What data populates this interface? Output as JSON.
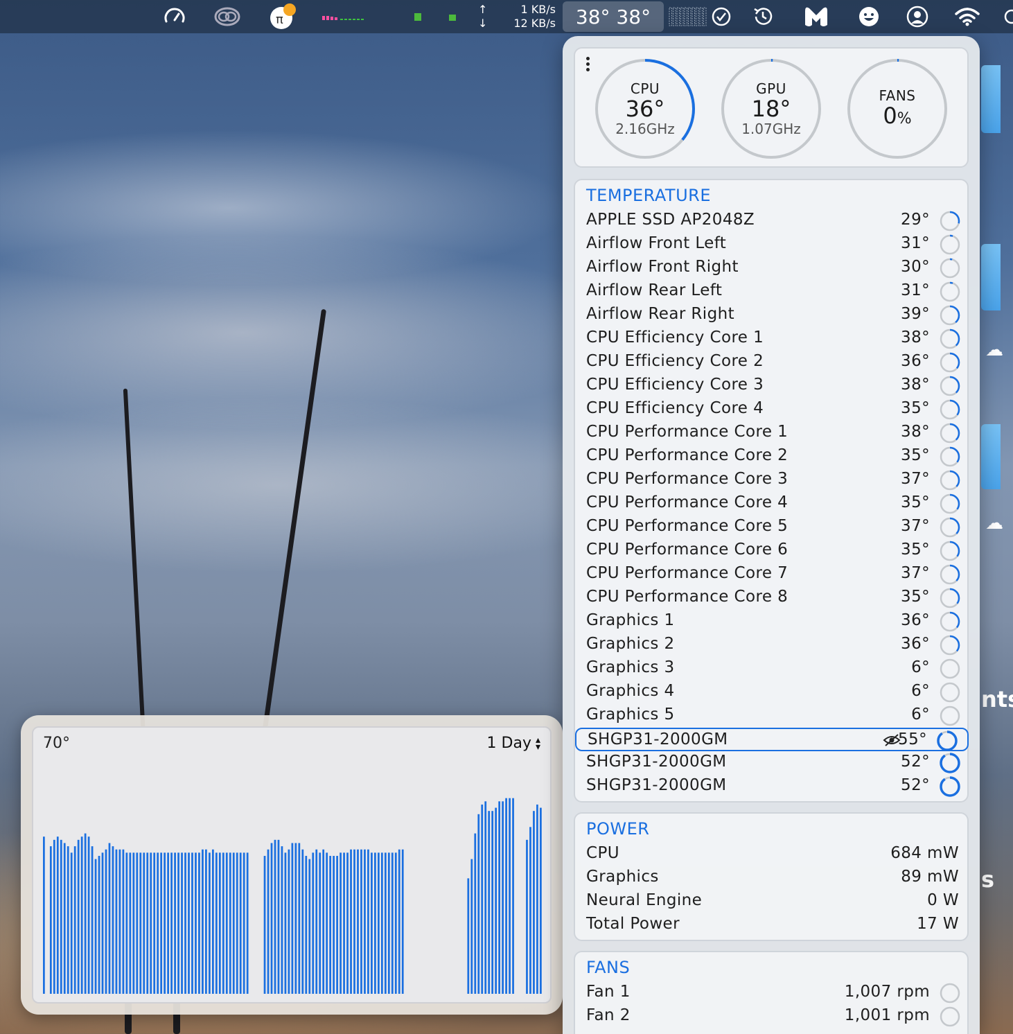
{
  "menubar": {
    "net_up": "1 KB/s",
    "net_down": "12 KB/s",
    "temps": "38° 38°",
    "icons": [
      "speedometer-icon",
      "creative-cloud-icon",
      "notification-badge-icon",
      "memory-bars-icon",
      "status-dots-icon",
      "network-arrows-icon",
      "cpu-grid-icon",
      "checkmark-circle-icon",
      "time-machine-icon",
      "malwarebytes-icon",
      "smiley-icon",
      "user-account-icon",
      "wifi-icon"
    ],
    "accent": "#1a6fe0"
  },
  "history": {
    "max_label": "70°",
    "range": "1 Day",
    "chart_data": {
      "type": "bar",
      "title": "",
      "xlabel": "",
      "ylabel": "",
      "ylim": [
        0,
        70
      ],
      "values": [
        49,
        0,
        46,
        48,
        49,
        48,
        47,
        46,
        44,
        46,
        48,
        49,
        50,
        49,
        46,
        42,
        43,
        44,
        45,
        47,
        46,
        45,
        45,
        45,
        44,
        44,
        44,
        44,
        44,
        44,
        44,
        44,
        44,
        44,
        44,
        44,
        44,
        44,
        44,
        44,
        44,
        44,
        44,
        44,
        44,
        44,
        45,
        45,
        44,
        45,
        44,
        44,
        44,
        44,
        44,
        44,
        44,
        44,
        44,
        44,
        0,
        0,
        0,
        0,
        43,
        45,
        47,
        48,
        48,
        46,
        44,
        45,
        47,
        47,
        47,
        45,
        43,
        42,
        44,
        45,
        44,
        45,
        44,
        43,
        43,
        43,
        44,
        44,
        44,
        45,
        45,
        45,
        45,
        45,
        45,
        44,
        44,
        44,
        44,
        44,
        44,
        44,
        44,
        45,
        45,
        0,
        0,
        0,
        0,
        0,
        0,
        0,
        0,
        0,
        0,
        0,
        0,
        0,
        0,
        0,
        0,
        0,
        0,
        36,
        42,
        50,
        56,
        59,
        60,
        57,
        57,
        58,
        60,
        60,
        61,
        61,
        61,
        0,
        0,
        0,
        48,
        52,
        57,
        59,
        58
      ]
    }
  },
  "gauges": [
    {
      "label": "CPU",
      "value": "36°",
      "sub": "2.16GHz",
      "fill": 0.36
    },
    {
      "label": "GPU",
      "value": "18°",
      "sub": "1.07GHz",
      "fill": 0.0
    },
    {
      "label": "FANS",
      "value": "0",
      "unit": "%",
      "sub": "",
      "fill": 0.0
    }
  ],
  "temperature": {
    "title": "TEMPERATURE",
    "rows": [
      {
        "name": "APPLE SSD AP2048Z",
        "value": "29°",
        "fill": 0.29
      },
      {
        "name": "Airflow Front Left",
        "value": "31°",
        "fill": 0.05
      },
      {
        "name": "Airflow Front Right",
        "value": "30°",
        "fill": 0.04
      },
      {
        "name": "Airflow Rear Left",
        "value": "31°",
        "fill": 0.05
      },
      {
        "name": "Airflow Rear Right",
        "value": "39°",
        "fill": 0.39
      },
      {
        "name": "CPU Efficiency Core 1",
        "value": "38°",
        "fill": 0.38
      },
      {
        "name": "CPU Efficiency Core 2",
        "value": "36°",
        "fill": 0.36
      },
      {
        "name": "CPU Efficiency Core 3",
        "value": "38°",
        "fill": 0.38
      },
      {
        "name": "CPU Efficiency Core 4",
        "value": "35°",
        "fill": 0.35
      },
      {
        "name": "CPU Performance Core 1",
        "value": "38°",
        "fill": 0.38
      },
      {
        "name": "CPU Performance Core 2",
        "value": "35°",
        "fill": 0.35
      },
      {
        "name": "CPU Performance Core 3",
        "value": "37°",
        "fill": 0.37
      },
      {
        "name": "CPU Performance Core 4",
        "value": "35°",
        "fill": 0.35
      },
      {
        "name": "CPU Performance Core 5",
        "value": "37°",
        "fill": 0.37
      },
      {
        "name": "CPU Performance Core 6",
        "value": "35°",
        "fill": 0.35
      },
      {
        "name": "CPU Performance Core 7",
        "value": "37°",
        "fill": 0.37
      },
      {
        "name": "CPU Performance Core 8",
        "value": "35°",
        "fill": 0.35
      },
      {
        "name": "Graphics 1",
        "value": "36°",
        "fill": 0.36
      },
      {
        "name": "Graphics 2",
        "value": "36°",
        "fill": 0.36
      },
      {
        "name": "Graphics 3",
        "value": "6°",
        "fill": 0.0
      },
      {
        "name": "Graphics 4",
        "value": "6°",
        "fill": 0.0
      },
      {
        "name": "Graphics 5",
        "value": "6°",
        "fill": 0.0
      },
      {
        "name": "SHGP31-2000GM",
        "value": "55°",
        "fill": 0.9,
        "selected": true,
        "hidden_from_menubar": true
      },
      {
        "name": "SHGP31-2000GM",
        "value": "52°",
        "fill": 0.9
      },
      {
        "name": "SHGP31-2000GM",
        "value": "52°",
        "fill": 0.9
      }
    ]
  },
  "power": {
    "title": "POWER",
    "rows": [
      {
        "name": "CPU",
        "value": "684 mW"
      },
      {
        "name": "Graphics",
        "value": "89 mW"
      },
      {
        "name": "Neural Engine",
        "value": "0 W"
      },
      {
        "name": "Total Power",
        "value": "17 W"
      }
    ]
  },
  "fans": {
    "title": "FANS",
    "rows": [
      {
        "name": "Fan 1",
        "value": "1,007 rpm",
        "fill": 0.0
      },
      {
        "name": "Fan 2",
        "value": "1,001 rpm",
        "fill": 0.0
      }
    ]
  },
  "desktop": {
    "partial_labels": [
      "nts",
      "s"
    ]
  }
}
